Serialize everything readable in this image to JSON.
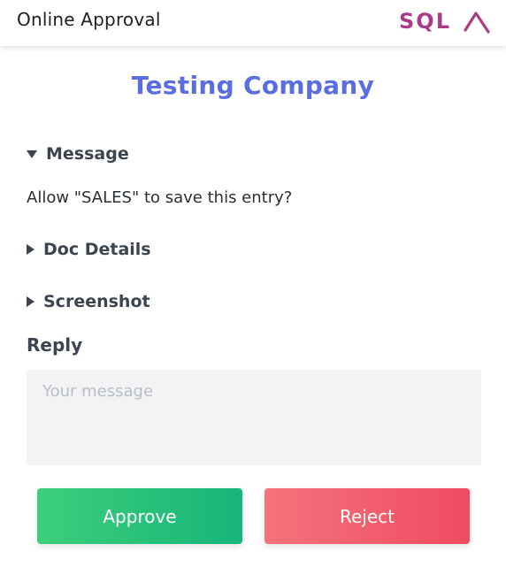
{
  "header": {
    "title": "Online Approval",
    "logo_text": "SQL",
    "logo_color": "#a83d86"
  },
  "company": {
    "name": "Testing Company",
    "color": "#5b6ee1"
  },
  "sections": {
    "message": {
      "label": "Message",
      "expanded": true,
      "body": "Allow \"SALES\" to save this entry?"
    },
    "doc_details": {
      "label": "Doc Details",
      "expanded": false
    },
    "screenshot": {
      "label": "Screenshot",
      "expanded": false
    }
  },
  "reply": {
    "label": "Reply",
    "placeholder": "Your message",
    "value": ""
  },
  "actions": {
    "approve_label": "Approve",
    "approve_color": "#17b57a",
    "reject_label": "Reject",
    "reject_color": "#ef4b62"
  },
  "icons": {
    "expanded": "caret-down-icon",
    "collapsed": "caret-right-icon"
  }
}
